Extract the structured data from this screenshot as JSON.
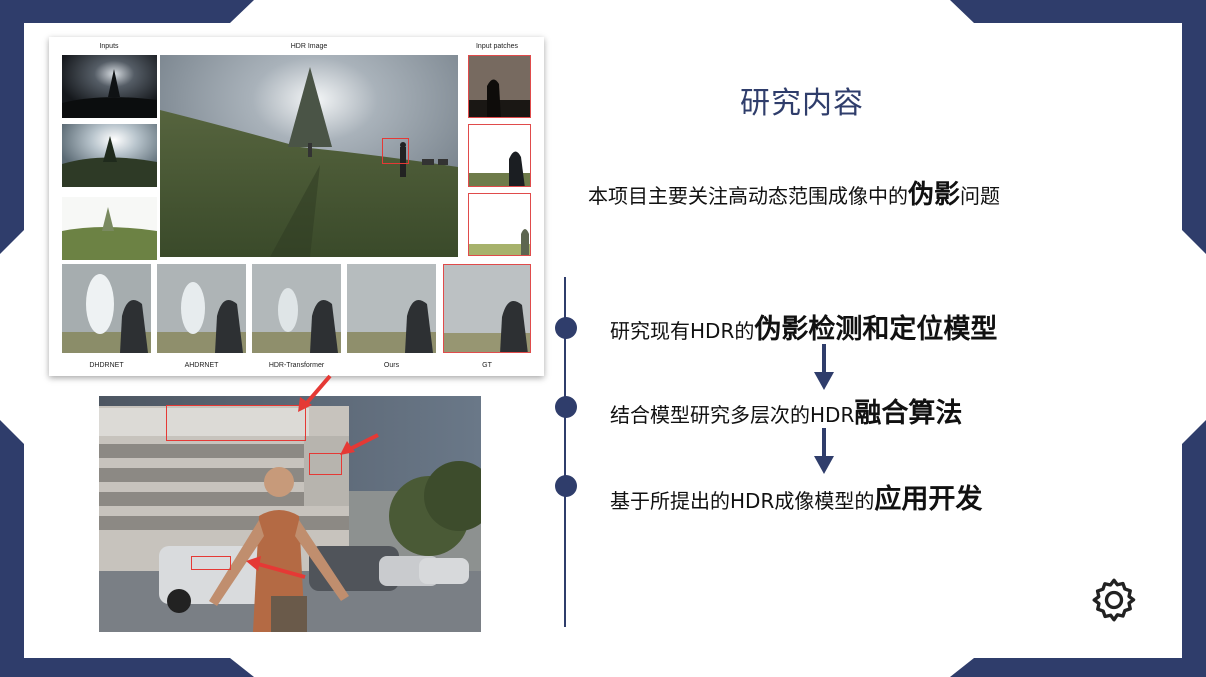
{
  "slide": {
    "title": "研究内容",
    "subtitle_prefix": "本项目主要关注高动态范围成像中的",
    "subtitle_bold": "伪影",
    "subtitle_suffix": "问题",
    "items": [
      {
        "prefix": "研究现有HDR的",
        "bold": "伪影检测和定位模型"
      },
      {
        "prefix": "结合模型研究多层次的HDR",
        "bold": "融合算法"
      },
      {
        "prefix": "基于所提出的HDR成像模型的",
        "bold": "应用开发"
      }
    ],
    "settings_icon": "gear-icon"
  },
  "figure": {
    "col_inputs": "Inputs",
    "col_hdr": "HDR Image",
    "col_patches": "Input patches",
    "methods": [
      "DHDRNET",
      "AHDRNET",
      "HDR-Transformer",
      "Ours",
      "GT"
    ]
  },
  "colors": {
    "frame": "#2f3d6b",
    "accent_red": "#e53935"
  }
}
